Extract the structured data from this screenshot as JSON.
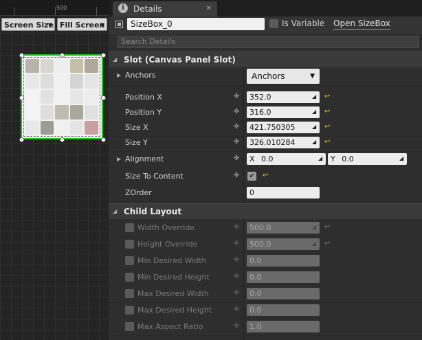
{
  "viewport": {
    "ruler_label": "500",
    "screen_combo": "Screen Size",
    "fill_combo": "Fill Screen",
    "preview_tiles": [
      "#b8b4ac",
      "#d8d6d0",
      "#eeeeee",
      "#c4c0a8",
      "#b0a898",
      "#e8e8e8",
      "#dcdcdc",
      "#f0f0f0",
      "#d4d4d4",
      "#e4e4e4",
      "#f4f4f4",
      "#e2e2e2",
      "#f2f2f2",
      "#e6e6e6",
      "#ececec",
      "#f4f4f4",
      "#dedede",
      "#bebcb0",
      "#a8a89a",
      "#e0e0e0",
      "#e8e8e8",
      "#9c9c94",
      "#f0f0f0",
      "#e4e4e4",
      "#c8a0a0"
    ]
  },
  "tab": {
    "icon": "info-icon",
    "title": "Details",
    "close": "✕"
  },
  "header": {
    "widget_name": "SizeBox_0",
    "is_variable_label": "Is Variable",
    "open_link": "Open SizeBox"
  },
  "search": {
    "placeholder": "Search Details"
  },
  "slot": {
    "title": "Slot (Canvas Panel Slot)",
    "anchors_label": "Anchors",
    "anchors_button": "Anchors",
    "position_x_label": "Position X",
    "position_x": "352.0",
    "position_y_label": "Position Y",
    "position_y": "316.0",
    "size_x_label": "Size X",
    "size_x": "421.750305",
    "size_y_label": "Size Y",
    "size_y": "326.010284",
    "alignment_label": "Alignment",
    "alignment_x_axis": "X",
    "alignment_x": "0.0",
    "alignment_y_axis": "Y",
    "alignment_y": "0.0",
    "size_to_content_label": "Size To Content",
    "size_to_content_checked": true,
    "zorder_label": "ZOrder",
    "zorder": "0"
  },
  "child_layout": {
    "title": "Child Layout",
    "rows": [
      {
        "label": "Width Override",
        "value": "500.0",
        "reset": true
      },
      {
        "label": "Height Override",
        "value": "500.0",
        "reset": true
      },
      {
        "label": "Min Desired Width",
        "value": "0.0",
        "reset": false
      },
      {
        "label": "Min Desired Height",
        "value": "0.0",
        "reset": false
      },
      {
        "label": "Max Desired Width",
        "value": "0.0",
        "reset": false
      },
      {
        "label": "Max Desired Height",
        "value": "0.0",
        "reset": false
      },
      {
        "label": "Max Aspect Ratio",
        "value": "1.0",
        "reset": false
      }
    ]
  },
  "colors": {
    "accent_green": "#1ec41e",
    "reset_yellow": "#e8c800"
  }
}
